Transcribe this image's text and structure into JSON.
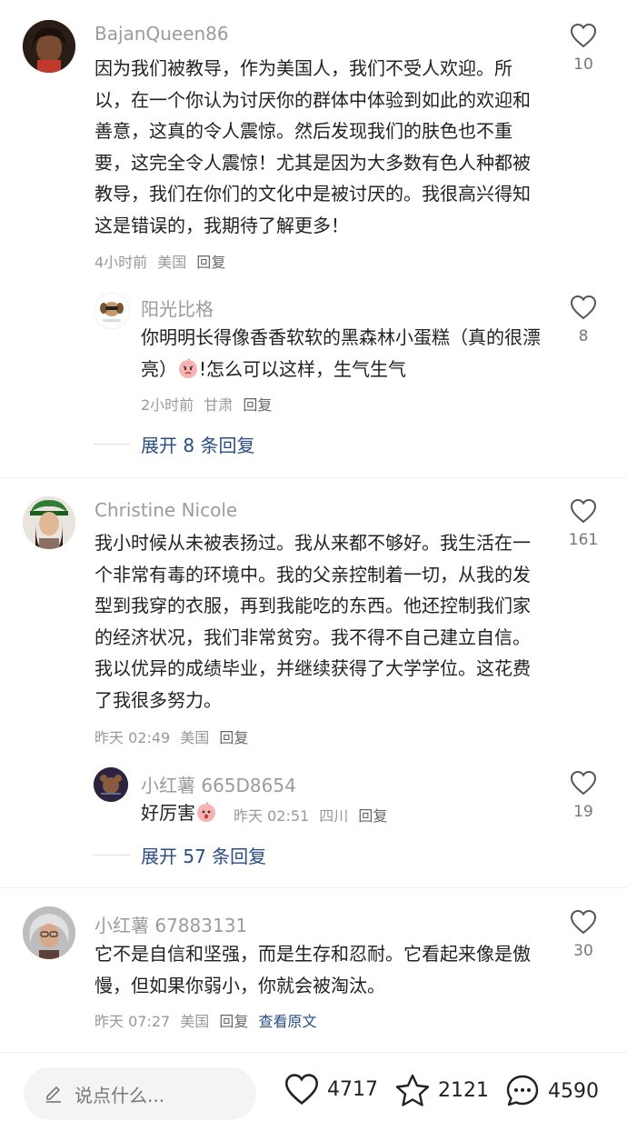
{
  "comments": [
    {
      "username": "BajanQueen86",
      "text": "因为我们被教导，作为美国人，我们不受人欢迎。所以，在一个你认为讨厌你的群体中体验到如此的欢迎和善意，这真的令人震惊。然后发现我们的肤色也不重要，这完全令人震惊！尤其是因为大多数有色人种都被教导，我们在你们的文化中是被讨厌的。我很高兴得知这是错误的，我期待了解更多！",
      "time": "4小时前",
      "location": "美国",
      "reply_label": "回复",
      "likes": "10",
      "reply": {
        "username": "阳光比格",
        "text_before": "你明明长得像香香软软的黑森林小蛋糕（真的很漂亮）",
        "text_after": "!怎么可以这样，生气生气",
        "time": "2小时前",
        "location": "甘肃",
        "reply_label": "回复",
        "likes": "8"
      },
      "expand_label": "展开 8 条回复"
    },
    {
      "username": "Christine Nicole",
      "text": "我小时候从未被表扬过。我从来都不够好。我生活在一个非常有毒的环境中。我的父亲控制着一切，从我的发型到我穿的衣服，再到我能吃的东西。他还控制我们家的经济状况，我们非常贫穷。我不得不自己建立自信。我以优异的成绩毕业，并继续获得了大学学位。这花费了我很多努力。",
      "time": "昨天 02:49",
      "location": "美国",
      "reply_label": "回复",
      "likes": "161",
      "reply": {
        "username": "小红薯 665D8654",
        "text_before": "好厉害",
        "time": "昨天 02:51",
        "location": "四川",
        "reply_label": "回复",
        "likes": "19"
      },
      "expand_label": "展开 57 条回复"
    },
    {
      "username": "小红薯 67883131",
      "text": "它不是自信和坚强，而是生存和忍耐。它看起来像是傲慢，但如果你弱小，你就会被淘汰。",
      "time": "昨天 07:27",
      "location": "美国",
      "reply_label": "回复",
      "view_original": "查看原文",
      "likes": "30"
    }
  ],
  "bottom_bar": {
    "input_placeholder": "说点什么...",
    "likes": "4717",
    "favorites": "2121",
    "comments": "4590"
  },
  "colors": {
    "link": "#2a4d86",
    "muted": "#999999",
    "emoji_pink": "#f7b3b3"
  }
}
